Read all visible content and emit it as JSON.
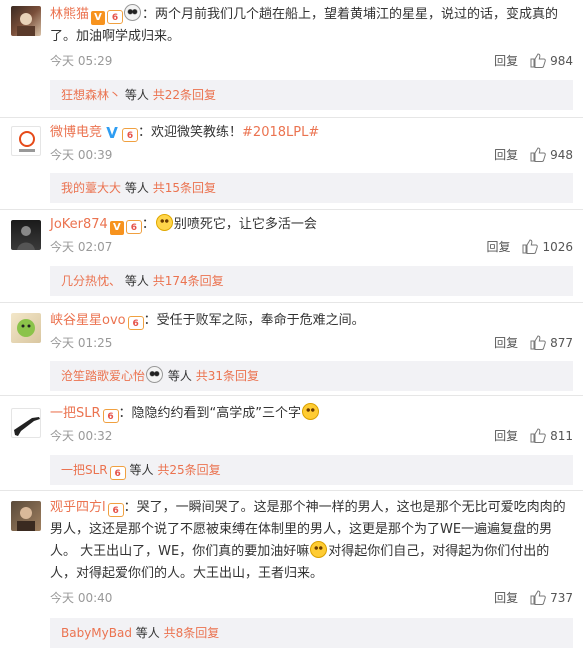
{
  "comments": [
    {
      "name": "林熊猫",
      "text": "：两个月前我们几个趟在船上，望着黄埔江的星星，说过的话，变成真的了。加油啊学成归来。",
      "time": "今天 05:29",
      "reply_label": "回复",
      "likes": "984",
      "sub": {
        "user": "狂想森林丶",
        "etc": "等人",
        "total": "共22条回复"
      }
    },
    {
      "name": "微博电竞",
      "text": "：欢迎微笑教练！",
      "hashtag": "#2018LPL#",
      "time": "今天 00:39",
      "reply_label": "回复",
      "likes": "948",
      "sub": {
        "user": "我的薹大大",
        "etc": "等人",
        "total": "共15条回复"
      }
    },
    {
      "name": "JoKer874",
      "text_pre": "：",
      "text": "别喷死它，让它多活一会",
      "time": "今天 02:07",
      "reply_label": "回复",
      "likes": "1026",
      "sub": {
        "user": "几分热忱、",
        "etc": "等人",
        "total": "共174条回复"
      }
    },
    {
      "name": "峡谷星星ovo",
      "text": "：受任于败军之际，奉命于危难之间。",
      "time": "今天 01:25",
      "reply_label": "回复",
      "likes": "877",
      "sub": {
        "user": "沧笙踏歌爱心怡",
        "etc": "等人",
        "total": "共31条回复"
      }
    },
    {
      "name": "一把SLR",
      "text": "：隐隐约约看到“高学成”三个字",
      "time": "今天 00:32",
      "reply_label": "回复",
      "likes": "811",
      "sub": {
        "user": "一把SLR",
        "etc": "等人",
        "total": "共25条回复"
      }
    },
    {
      "name": "观乎四方l",
      "text_a": "：哭了，一瞬间哭了。这是那个神一样的男人，这也是那个无比可爱吃肉肉的男人，这还是那个说了不愿被束缚在体制里的男人，这更是那个为了WE一遍遍复盘的男人。 大王出山了，WE，你们真的要加油好嘛",
      "text_b": "对得起你们自己，对得起为你们付出的人，对得起爱你们的人。大王出山，王者归来。",
      "time": "今天 00:40",
      "reply_label": "回复",
      "likes": "737",
      "sub": {
        "user": "BabyMyBad",
        "etc": "等人",
        "total": "共8条回复"
      }
    }
  ],
  "badges": {
    "verified_orange": "V",
    "verified_blue": "V",
    "level": "6"
  },
  "colors": {
    "username": "#eb7350",
    "subreply_bg": "#f2f2f5",
    "meta": "#999999"
  },
  "icons": {
    "like": "thumbs-up-icon",
    "panda": "panda-emoji-icon",
    "face": "smile-emoji-icon"
  }
}
